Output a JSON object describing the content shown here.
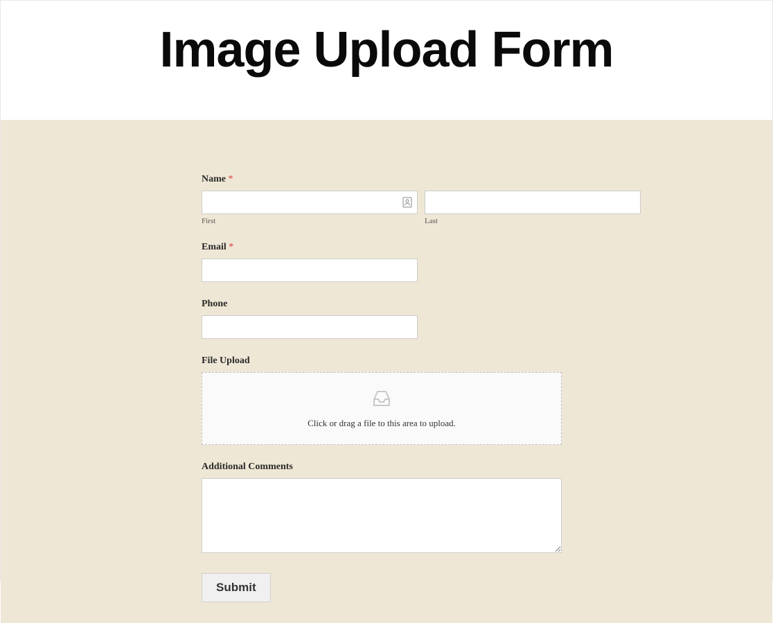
{
  "header": {
    "title": "Image Upload Form"
  },
  "form": {
    "name": {
      "label": "Name",
      "required_mark": "*",
      "first_sublabel": "First",
      "last_sublabel": "Last",
      "first_value": "",
      "last_value": ""
    },
    "email": {
      "label": "Email",
      "required_mark": "*",
      "value": ""
    },
    "phone": {
      "label": "Phone",
      "value": ""
    },
    "file_upload": {
      "label": "File Upload",
      "dropzone_text": "Click or drag a file to this area to upload."
    },
    "comments": {
      "label": "Additional Comments",
      "value": ""
    },
    "submit_label": "Submit"
  }
}
